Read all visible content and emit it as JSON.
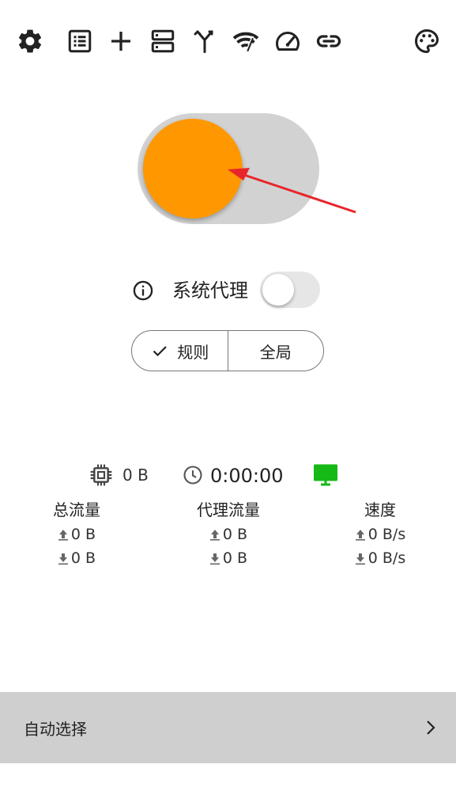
{
  "toolbar": {
    "icons": [
      "gear-icon",
      "list-icon",
      "plus-icon",
      "server-icon",
      "merge-icon",
      "wifi-signal-icon",
      "speedometer-icon",
      "link-icon",
      "palette-icon"
    ]
  },
  "proxy_switch": {
    "on": false,
    "knob_color": "#ff9800",
    "track_color": "#d2d2d2"
  },
  "system_proxy": {
    "label": "系统代理",
    "enabled": false
  },
  "mode": {
    "rule_label": "规则",
    "global_label": "全局",
    "selected": "规则"
  },
  "status": {
    "memory": "0 B",
    "uptime": "0:00:00",
    "monitor_color": "#17b917"
  },
  "traffic": {
    "total": {
      "title": "总流量",
      "up": "0 B",
      "down": "0 B"
    },
    "proxy": {
      "title": "代理流量",
      "up": "0 B",
      "down": "0 B"
    },
    "speed": {
      "title": "速度",
      "up": "0 B/s",
      "down": "0 B/s"
    }
  },
  "bottom": {
    "label": "自动选择"
  }
}
